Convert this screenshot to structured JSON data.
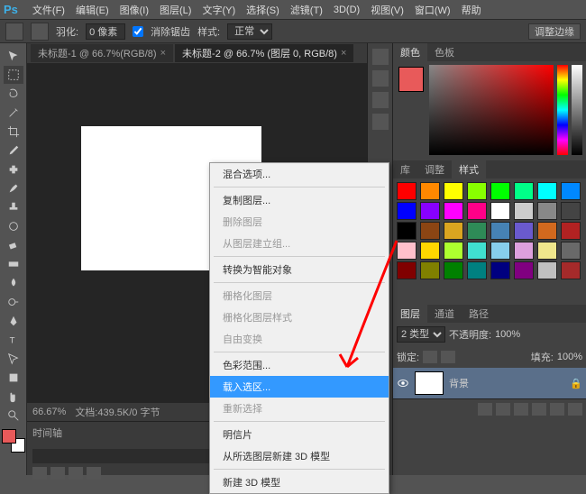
{
  "menubar": {
    "logo": "Ps",
    "items": [
      "文件(F)",
      "编辑(E)",
      "图像(I)",
      "图层(L)",
      "文字(Y)",
      "选择(S)",
      "滤镜(T)",
      "3D(D)",
      "视图(V)",
      "窗口(W)",
      "帮助"
    ]
  },
  "optionsbar": {
    "feather_label": "羽化:",
    "feather_value": "0 像素",
    "antialias_label": "消除锯齿",
    "style_label": "样式:",
    "style_value": "正常",
    "adjust_edge": "调整边缘"
  },
  "tabs": [
    {
      "label": "未标题-1 @ 66.7%(RGB/8)",
      "active": false
    },
    {
      "label": "未标题-2 @ 66.7% (图层 0, RGB/8)",
      "active": true
    }
  ],
  "bottombar": {
    "zoom": "66.67%",
    "doc": "文档:439.5K/0 字节"
  },
  "timeline": {
    "label": "时间轴"
  },
  "panels": {
    "color_tabs": [
      "颜色",
      "色板"
    ],
    "styles_tabs": [
      "库",
      "调整",
      "样式"
    ],
    "layers_tabs": [
      "图层",
      "通道",
      "路径"
    ],
    "layer_kind": "2 类型",
    "opacity_label": "不透明度:",
    "opacity_value": "100%",
    "lock_label": "锁定:",
    "fill_label": "填充:",
    "fill_value": "100%",
    "layer0_name": "背景"
  },
  "context_menu": {
    "items": [
      {
        "label": "混合选项...",
        "enabled": true
      },
      {
        "sep": true
      },
      {
        "label": "复制图层...",
        "enabled": true
      },
      {
        "label": "删除图层",
        "enabled": false
      },
      {
        "label": "从图层建立组...",
        "enabled": false
      },
      {
        "sep": true
      },
      {
        "label": "转换为智能对象",
        "enabled": true
      },
      {
        "sep": true
      },
      {
        "label": "栅格化图层",
        "enabled": false
      },
      {
        "label": "栅格化图层样式",
        "enabled": false
      },
      {
        "label": "自由变换",
        "enabled": false
      },
      {
        "sep": true
      },
      {
        "label": "色彩范围...",
        "enabled": true
      },
      {
        "label": "载入选区...",
        "enabled": true,
        "highlight": true
      },
      {
        "label": "重新选择",
        "enabled": false
      },
      {
        "sep": true
      },
      {
        "label": "明信片",
        "enabled": true
      },
      {
        "label": "从所选图层新建 3D 模型",
        "enabled": true
      },
      {
        "sep": true
      },
      {
        "label": "新建 3D 模型",
        "enabled": true
      }
    ]
  },
  "swatches": [
    "#ff0000",
    "#ff8800",
    "#ffff00",
    "#88ff00",
    "#00ff00",
    "#00ff88",
    "#00ffff",
    "#0088ff",
    "#0000ff",
    "#8800ff",
    "#ff00ff",
    "#ff0088",
    "#ffffff",
    "#cccccc",
    "#888888",
    "#444444",
    "#000000",
    "#8b4513",
    "#daa520",
    "#2e8b57",
    "#4682b4",
    "#6a5acd",
    "#d2691e",
    "#b22222",
    "#ffc0cb",
    "#ffd700",
    "#adff2f",
    "#40e0d0",
    "#87ceeb",
    "#dda0dd",
    "#f0e68c",
    "#696969",
    "#800000",
    "#808000",
    "#008000",
    "#008080",
    "#000080",
    "#800080",
    "#c0c0c0",
    "#a52a2a"
  ]
}
